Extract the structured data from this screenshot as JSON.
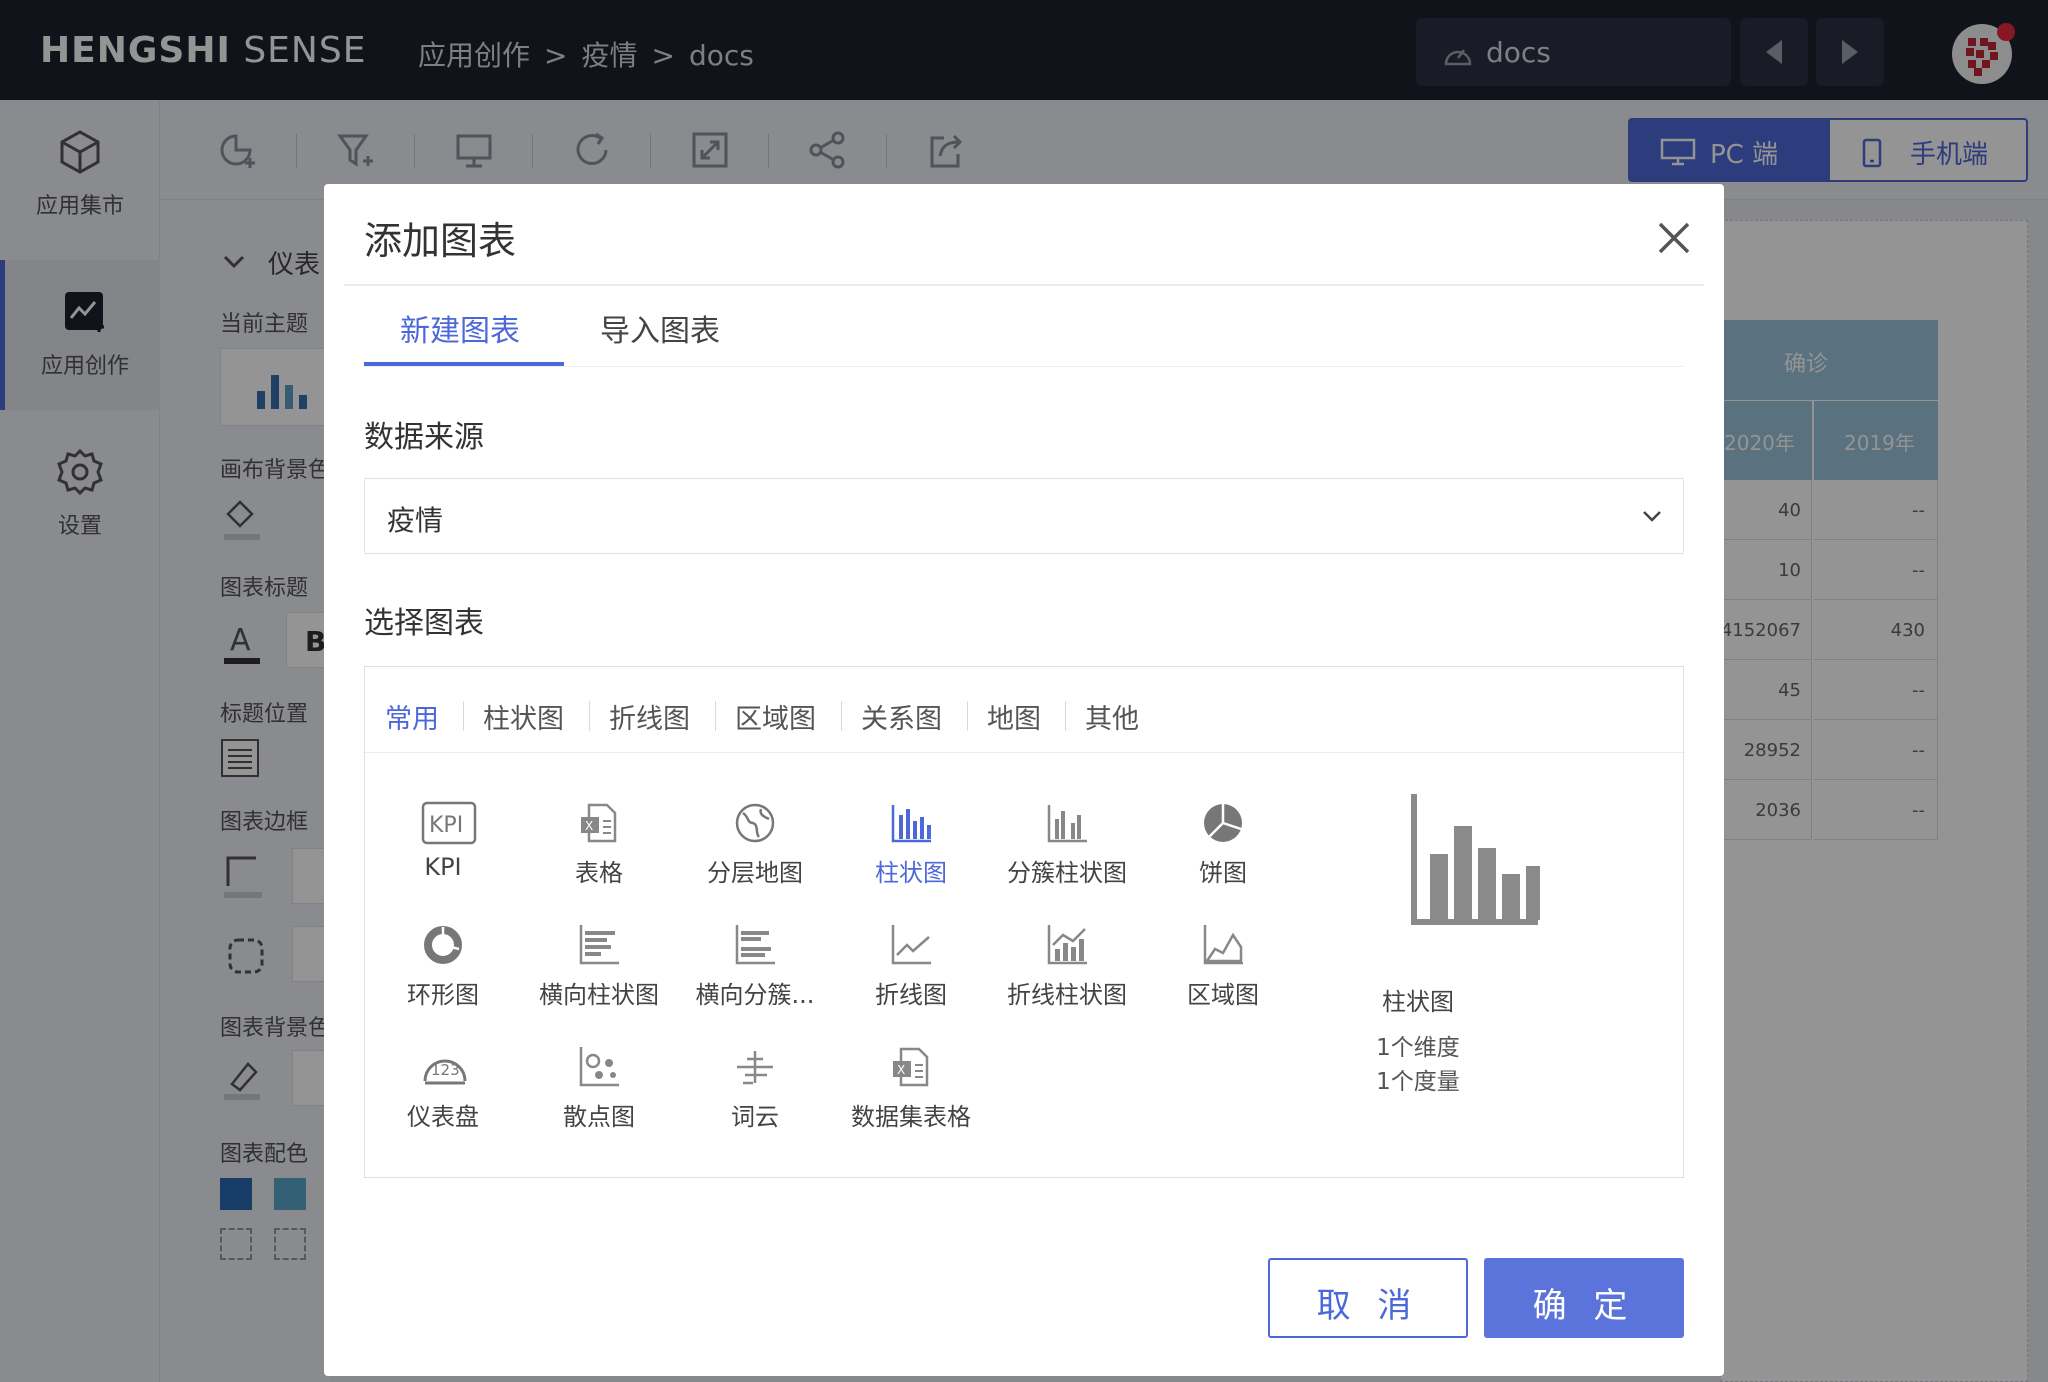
{
  "app": {
    "brand_bold": "HENGSHI",
    "brand_light": "SENSE"
  },
  "breadcrumb": [
    "应用创作",
    "疫情",
    "docs"
  ],
  "breadcrumb_sep": ">",
  "top_search": {
    "value": "docs"
  },
  "rail": [
    {
      "label": "应用集市",
      "icon": "cube-icon"
    },
    {
      "label": "应用创作",
      "icon": "chart-create-icon"
    },
    {
      "label": "设置",
      "icon": "gear-icon"
    }
  ],
  "toolbar": {
    "device_pc": "PC 端",
    "device_mobile": "手机端"
  },
  "panel": {
    "head": "仪表",
    "labels": [
      "当前主题",
      "画布背景色",
      "图表标题",
      "标题位置",
      "图表边框",
      "图表背景色",
      "图表配色"
    ]
  },
  "background_table": {
    "group": "确诊",
    "years": [
      "2020年",
      "2019年"
    ],
    "rows": [
      [
        "40",
        "--"
      ],
      [
        "10",
        "--"
      ],
      [
        "4152067",
        "430"
      ],
      [
        "45",
        "--"
      ],
      [
        "28952",
        "--"
      ],
      [
        "2036",
        "--"
      ]
    ]
  },
  "modal": {
    "title": "添加图表",
    "tabs": [
      "新建图表",
      "导入图表"
    ],
    "source_label": "数据来源",
    "source_value": "疫情",
    "choose_label": "选择图表",
    "chart_tabs": [
      "常用",
      "柱状图",
      "折线图",
      "区域图",
      "关系图",
      "地图",
      "其他"
    ],
    "charts": [
      {
        "label": "KPI",
        "icon": "kpi-icon"
      },
      {
        "label": "表格",
        "icon": "table-icon"
      },
      {
        "label": "分层地图",
        "icon": "globe-icon"
      },
      {
        "label": "柱状图",
        "icon": "bar-chart-icon"
      },
      {
        "label": "分簇柱状图",
        "icon": "cluster-bar-icon"
      },
      {
        "label": "饼图",
        "icon": "pie-icon"
      },
      {
        "label": "环形图",
        "icon": "donut-icon"
      },
      {
        "label": "横向柱状图",
        "icon": "hbar-icon"
      },
      {
        "label": "横向分簇...",
        "icon": "hbar-cluster-icon"
      },
      {
        "label": "折线图",
        "icon": "line-icon"
      },
      {
        "label": "折线柱状图",
        "icon": "line-bar-icon"
      },
      {
        "label": "区域图",
        "icon": "area-icon"
      },
      {
        "label": "仪表盘",
        "icon": "gauge-icon"
      },
      {
        "label": "散点图",
        "icon": "scatter-icon"
      },
      {
        "label": "词云",
        "icon": "wordcloud-icon"
      },
      {
        "label": "数据集表格",
        "icon": "dataset-table-icon"
      }
    ],
    "preview": {
      "name": "柱状图",
      "dims": "1个维度",
      "measures": "1个度量"
    },
    "cancel": "取 消",
    "ok": "确 定"
  },
  "colors": {
    "accent": "#4d68d8",
    "topbar": "#1e2230"
  }
}
